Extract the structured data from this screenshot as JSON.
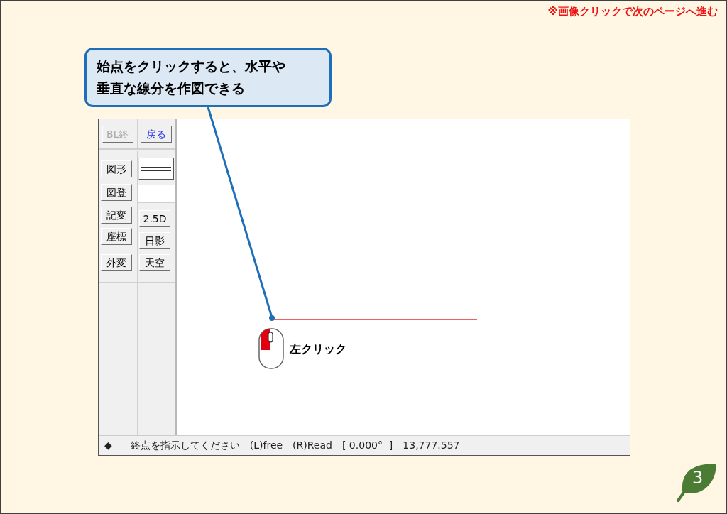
{
  "notice": "※画像クリックで次のページへ進む",
  "callout": [
    "始点をクリックすると、水平や",
    "垂直な線分を作図できる"
  ],
  "top_buttons": [
    {
      "label": "BL終",
      "disabled": true
    },
    {
      "label": "戻る",
      "disabled": false
    }
  ],
  "left_buttons": [
    "図形",
    "図登",
    "記変",
    "座標",
    "外変"
  ],
  "right_buttons": [
    "2.5D",
    "日影",
    "天空"
  ],
  "mouse_label": "左クリック",
  "status_bar": {
    "marker": "◆",
    "parts": [
      "終点を指示してください",
      "(L)free",
      "(R)Read",
      "[ 0.000°  ]",
      "13,777.557"
    ]
  },
  "page_number": "3"
}
